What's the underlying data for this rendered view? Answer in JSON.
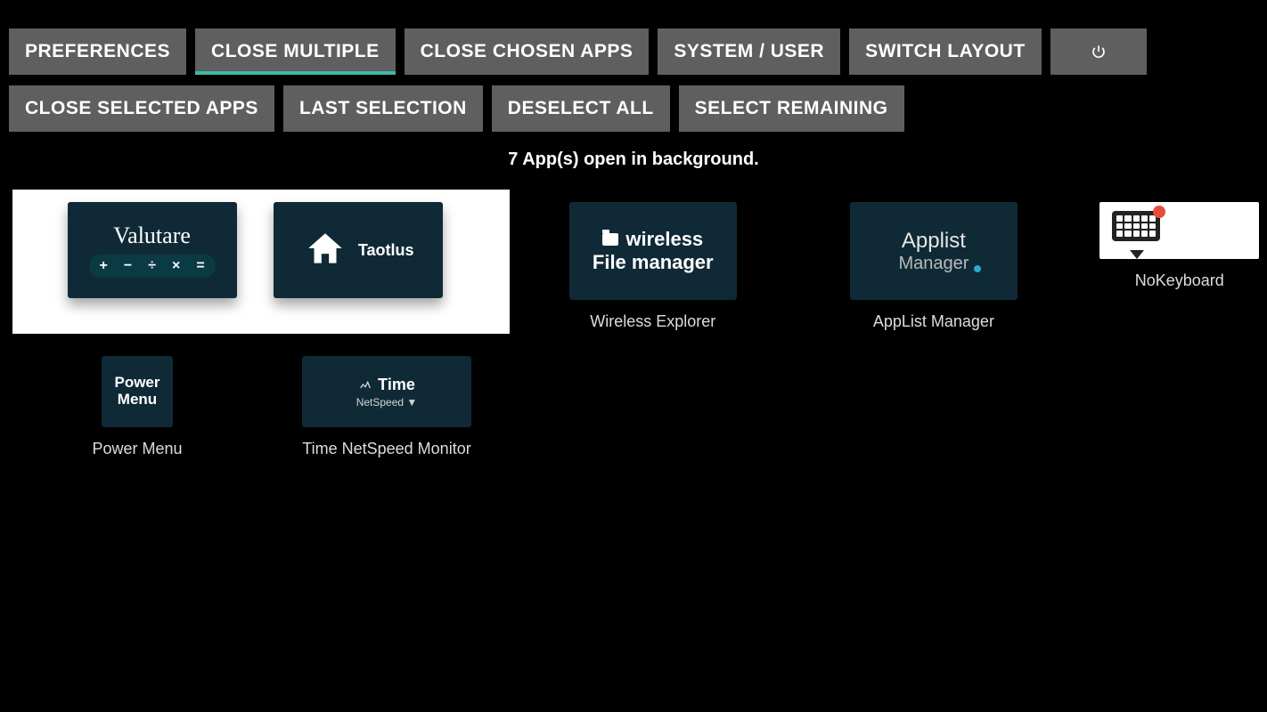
{
  "toolbar_top": [
    {
      "id": "preferences",
      "label": "PREFERENCES",
      "active": false
    },
    {
      "id": "close-multiple",
      "label": "CLOSE MULTIPLE",
      "active": true
    },
    {
      "id": "close-chosen-apps",
      "label": "CLOSE CHOSEN APPS",
      "active": false
    },
    {
      "id": "system-user",
      "label": "SYSTEM / USER",
      "active": false
    },
    {
      "id": "switch-layout",
      "label": "SWITCH LAYOUT",
      "active": false
    }
  ],
  "toolbar_top_icon": {
    "id": "power",
    "icon": "power-icon"
  },
  "toolbar_bottom": [
    {
      "id": "close-selected-apps",
      "label": "CLOSE SELECTED APPS"
    },
    {
      "id": "last-selection",
      "label": "LAST SELECTION"
    },
    {
      "id": "deselect-all",
      "label": "DESELECT ALL"
    },
    {
      "id": "select-remaining",
      "label": "SELECT REMAINING"
    }
  ],
  "status_text": "7 App(s) open in background.",
  "apps": {
    "row1": [
      {
        "id": "valutare",
        "tile_title": "Valutare",
        "tile_ops": [
          "+",
          "−",
          "÷",
          "×",
          "="
        ],
        "label": "",
        "selected": true
      },
      {
        "id": "taotlus",
        "tile_title": "Taotlus",
        "label": "",
        "selected": true
      },
      {
        "id": "wireless-explorer",
        "tile_line1": "wireless",
        "tile_line2": "File manager",
        "label": "Wireless Explorer",
        "selected": false
      },
      {
        "id": "applist-manager",
        "tile_line1": "Applist",
        "tile_line2": "Manager",
        "label": "AppList Manager",
        "selected": false
      },
      {
        "id": "nokeyboard",
        "tile_title": "NoKeyboard",
        "label": "NoKeyboard",
        "selected": false
      }
    ],
    "row2": [
      {
        "id": "power-menu",
        "tile_line1": "Power",
        "tile_line2": "Menu",
        "label": "Power Menu"
      },
      {
        "id": "time-netspeed",
        "tile_line1": "Time",
        "tile_line2": "NetSpeed ▼",
        "label": "Time NetSpeed Monitor"
      }
    ]
  }
}
